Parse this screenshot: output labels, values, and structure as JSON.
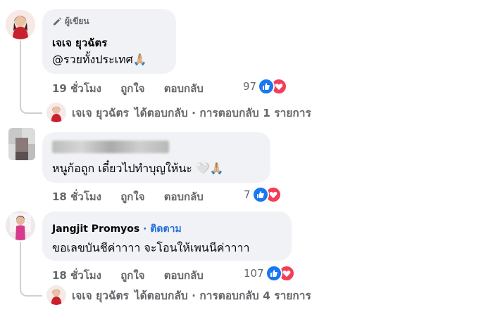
{
  "comments": [
    {
      "author_badge": "ผู้เขียน",
      "name": "เจเจ ยุวฉัตร",
      "text": "@รวยทั้งประเทศ🙏🏼",
      "time": "19 ชั่วโมง",
      "like": "ถูกใจ",
      "reply": "ตอบกลับ",
      "reactions": "97",
      "replies_summary": {
        "name": "เจเจ ยุวฉัตร",
        "text": "ได้ตอบกลับ · การตอบกลับ 1 รายการ"
      }
    },
    {
      "text": "หนูก้อถูก เดี๋ยวไปทำบุญให้นะ 🤍🙏🏼",
      "time": "18 ชั่วโมง",
      "like": "ถูกใจ",
      "reply": "ตอบกลับ",
      "reactions": "7"
    },
    {
      "name": "Jangjit Promyos",
      "follow": "· ติดตาม",
      "text": "ขอเลขบันชีค่าาาา จะโอนให้เพนนีค่าาาา",
      "time": "18 ชั่วโมง",
      "like": "ถูกใจ",
      "reply": "ตอบกลับ",
      "reactions": "107",
      "replies_summary": {
        "name": "เจเจ ยุวฉัตร",
        "text": "ได้ตอบกลับ · การตอบกลับ 4 รายการ"
      }
    }
  ],
  "colors": {
    "bubble": "#f0f2f5",
    "meta": "#65676b",
    "link": "#216fdb",
    "like": "#1877f2",
    "love": "#f33e58"
  },
  "icons": [
    "pencil-icon",
    "like-reaction-icon",
    "love-reaction-icon"
  ]
}
